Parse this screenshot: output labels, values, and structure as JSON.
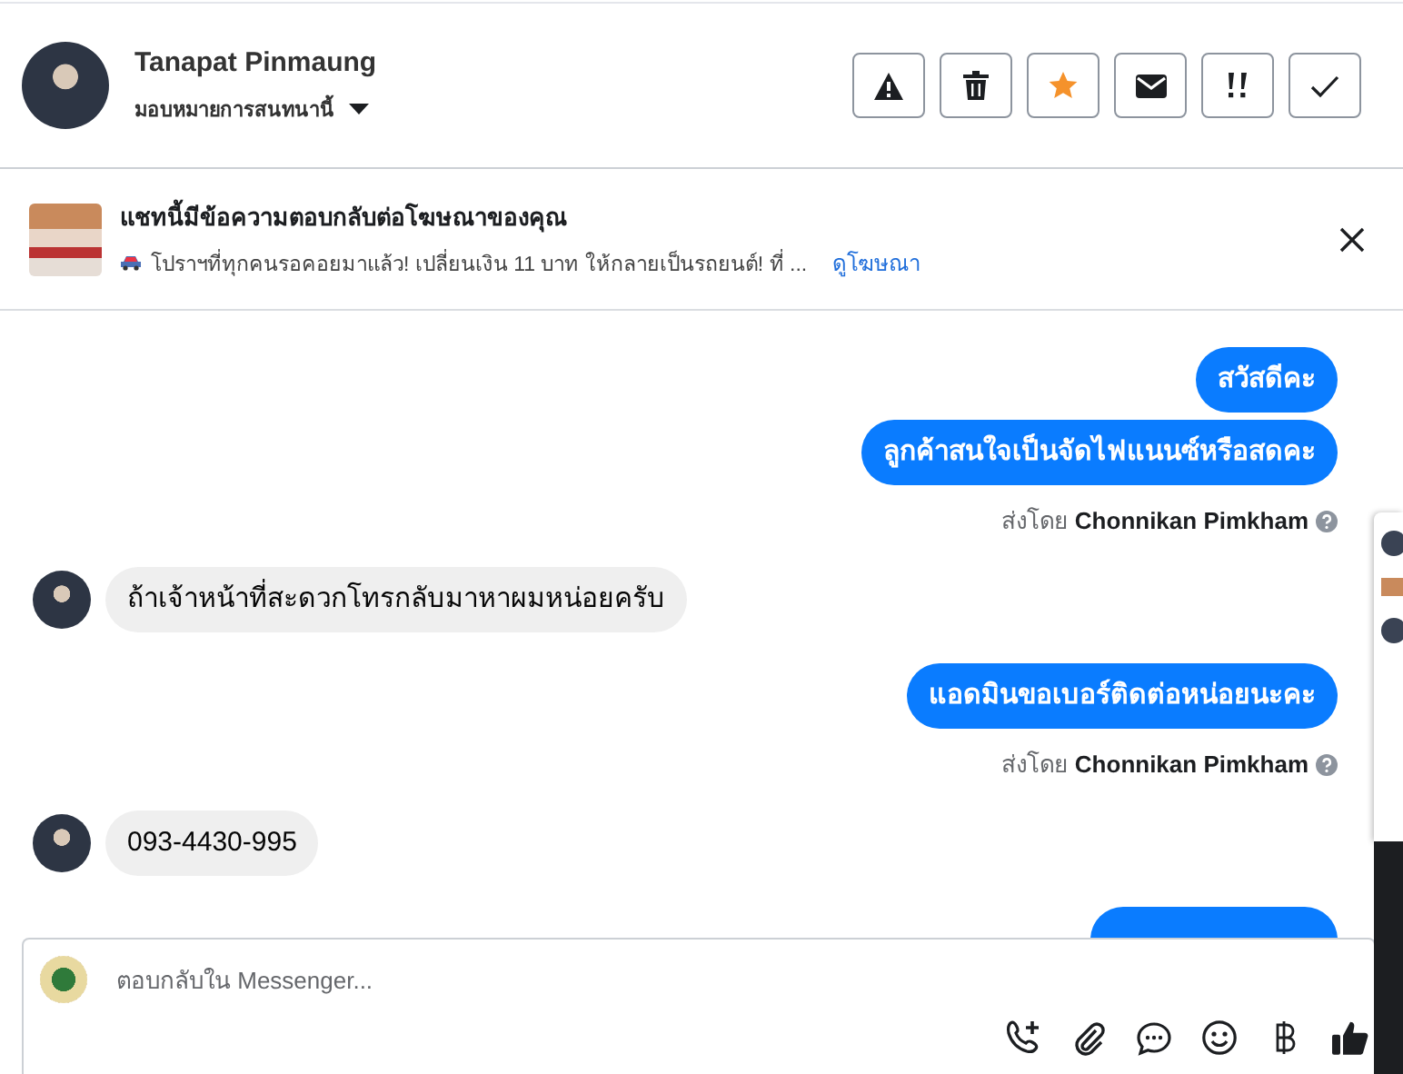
{
  "header": {
    "name": "Tanapat Pinmaung",
    "assign_label": "มอบหมายการสนทนานี้",
    "actions": [
      {
        "kind": "spam",
        "active": false
      },
      {
        "kind": "delete",
        "active": false
      },
      {
        "kind": "star",
        "active": true
      },
      {
        "kind": "unread",
        "active": false
      },
      {
        "kind": "followup",
        "active": false
      },
      {
        "kind": "done",
        "active": false
      }
    ]
  },
  "ad_banner": {
    "title": "แชทนี้มีข้อความตอบกลับต่อโฆษณาของคุณ",
    "snippet": "โปราฯที่ทุกคนรอคอยมาแล้ว! เปลี่ยนเงิน 11 บาท ให้กลายเป็นรถยนต์! ที่ ...",
    "link": "ดูโฆษณา"
  },
  "messages": [
    {
      "kind": "outgoing",
      "text": "สวัสดีคะ"
    },
    {
      "kind": "outgoing",
      "text": "ลูกค้าสนใจเป็นจัดไฟแนนซ์หรือสดคะ"
    },
    {
      "kind": "sent_by",
      "prefix": "ส่งโดย",
      "name": "Chonnikan Pimkham"
    },
    {
      "kind": "incoming",
      "text": "ถ้าเจ้าหน้าที่สะดวกโทรกลับมาหาผมหน่อยครับ"
    },
    {
      "kind": "outgoing",
      "text": "แอดมินขอเบอร์ติดต่อหน่อยนะคะ"
    },
    {
      "kind": "sent_by",
      "prefix": "ส่งโดย",
      "name": "Chonnikan Pimkham"
    },
    {
      "kind": "incoming",
      "text": "093-4430-995"
    },
    {
      "kind": "partial"
    }
  ],
  "composer": {
    "placeholder": "ตอบกลับใน Messenger...",
    "tools": [
      {
        "kind": "call"
      },
      {
        "kind": "attach"
      },
      {
        "kind": "saved-reply"
      },
      {
        "kind": "emoji"
      },
      {
        "kind": "baht"
      },
      {
        "kind": "like"
      }
    ]
  }
}
